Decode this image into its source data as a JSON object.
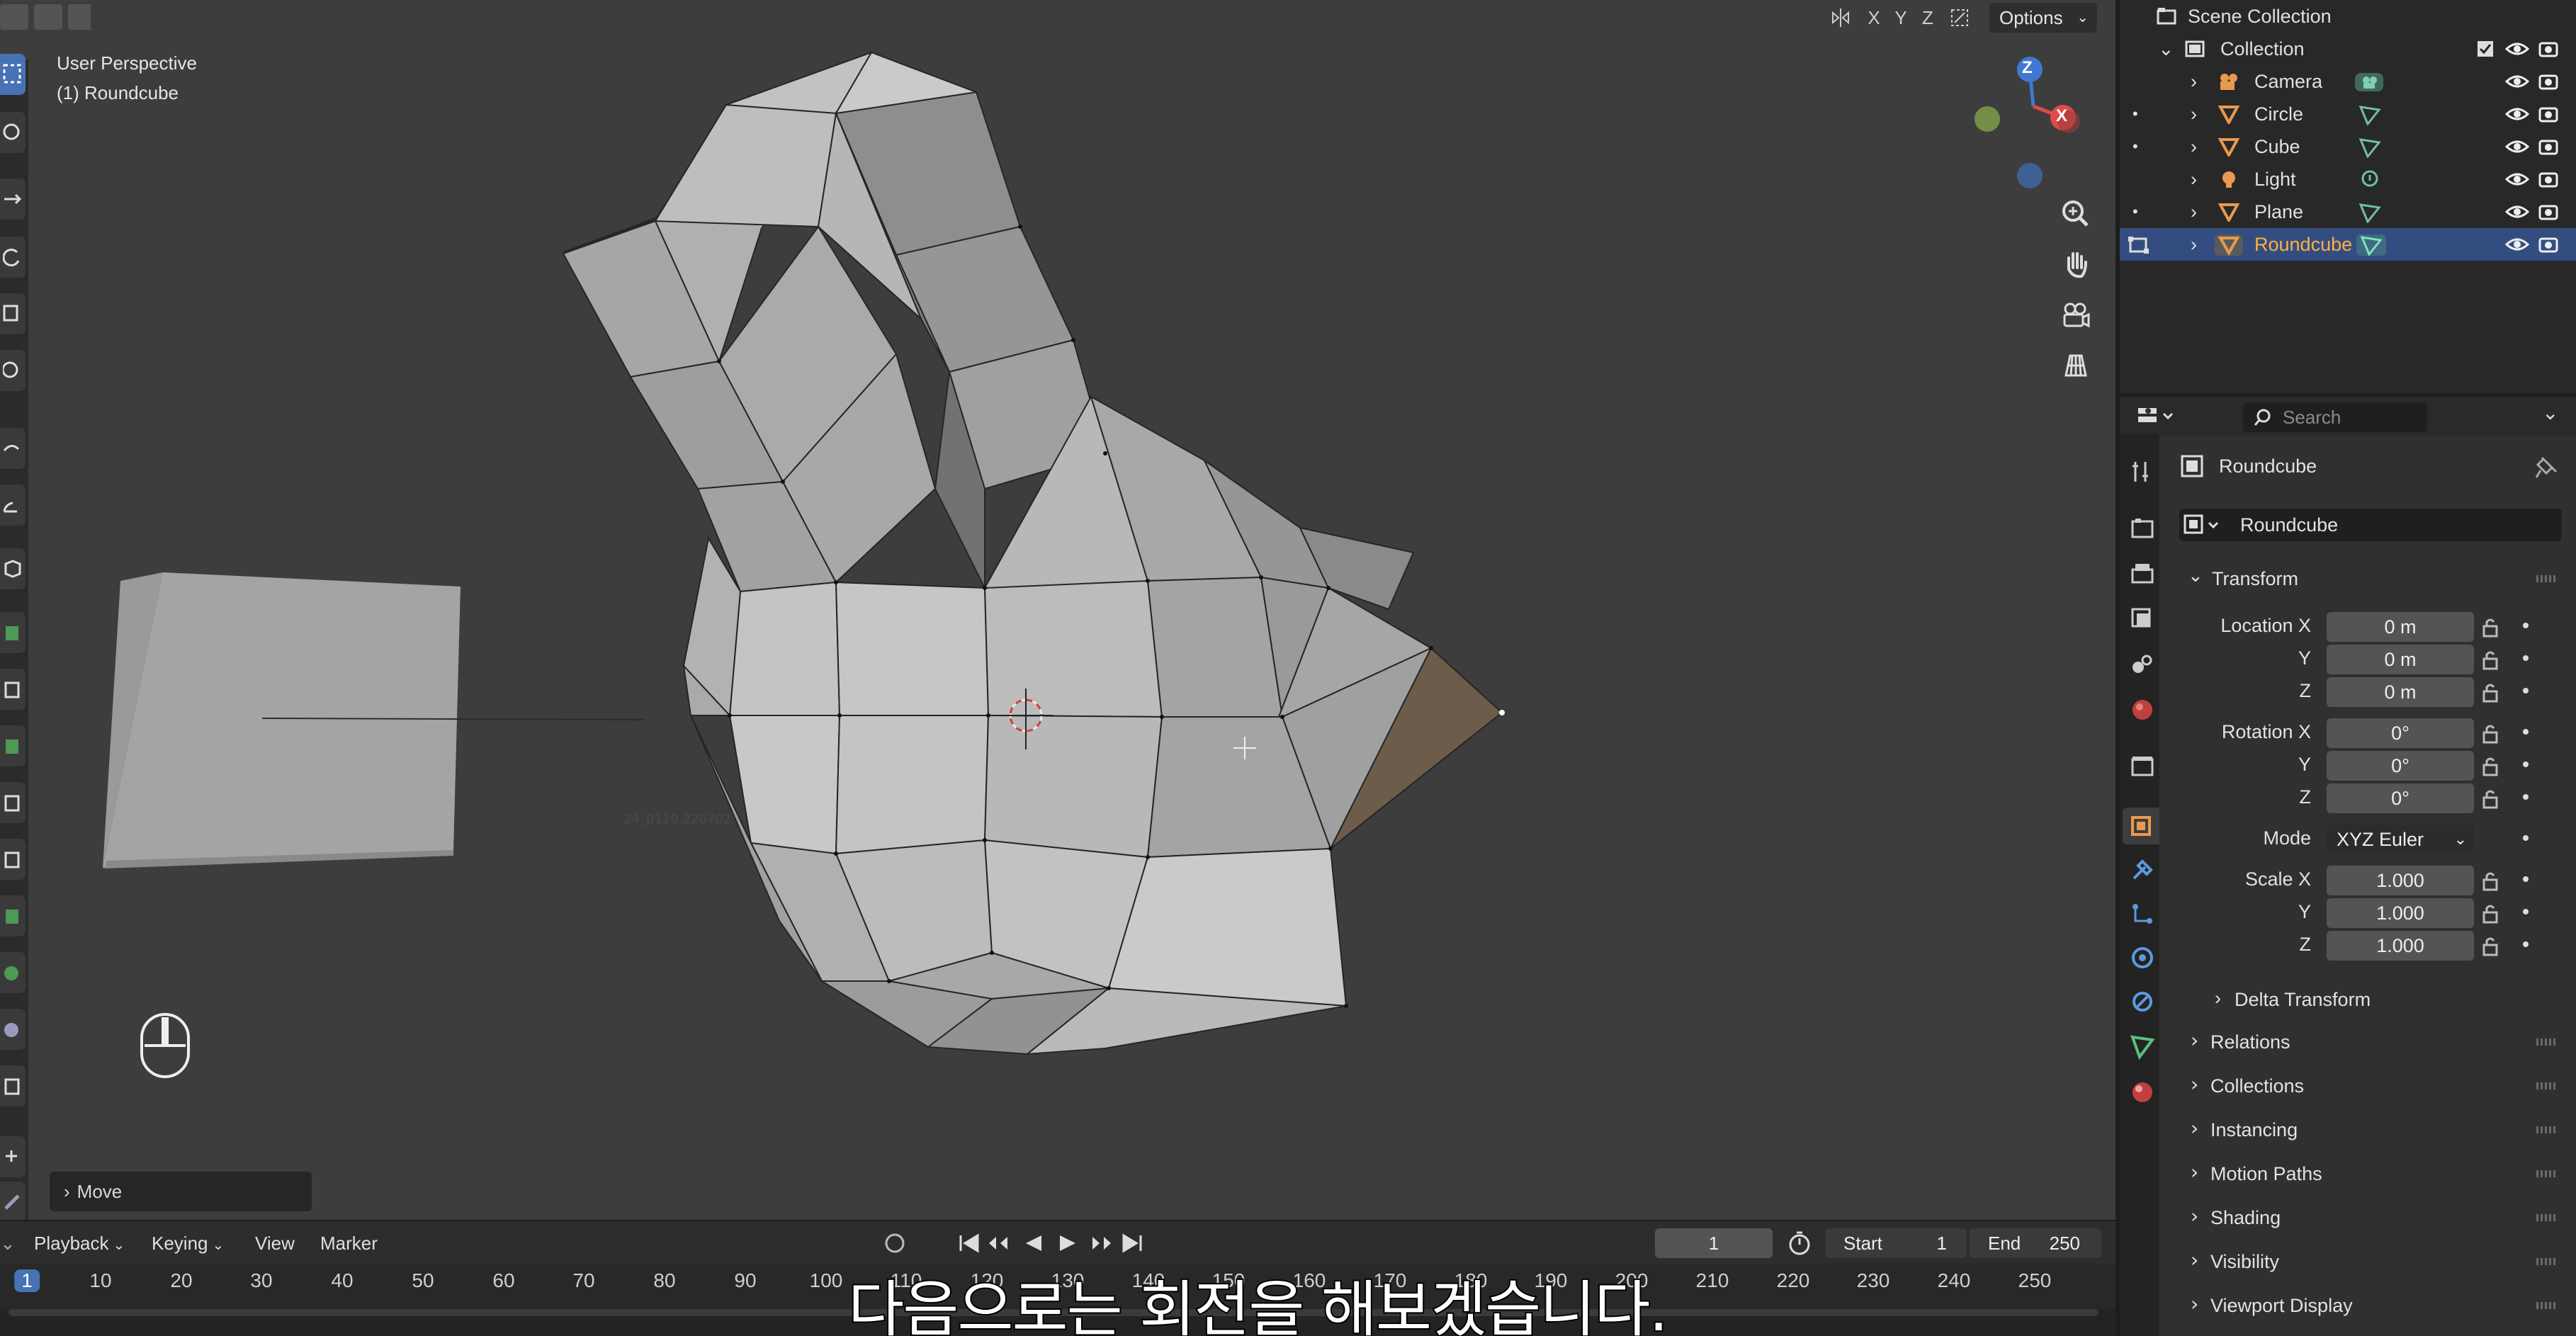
{
  "viewport": {
    "perspective_label": "User Perspective",
    "object_label": "(1) Roundcube",
    "faint_label": "24_0110 220702",
    "axis_buttons": [
      "X",
      "Y",
      "Z"
    ],
    "options_label": "Options",
    "gizmo": {
      "x": "X",
      "y": "Y",
      "z": "Z"
    },
    "operator_panel": "Move"
  },
  "timeline": {
    "menus": {
      "playback": "Playback",
      "keying": "Keying",
      "view": "View",
      "marker": "Marker"
    },
    "current_frame": "1",
    "start_label": "Start",
    "start_value": "1",
    "end_label": "End",
    "end_value": "250",
    "ruler": [
      "1",
      "10",
      "20",
      "30",
      "40",
      "50",
      "60",
      "70",
      "80",
      "90",
      "100",
      "110",
      "120",
      "130",
      "140",
      "150",
      "160",
      "170",
      "180",
      "190",
      "200",
      "210",
      "220",
      "230",
      "240",
      "250"
    ]
  },
  "subtitle": "다음으로는 회전을 해보겠습니다.",
  "outliner": {
    "scene_collection": "Scene Collection",
    "collection": "Collection",
    "items": [
      {
        "name": "Camera",
        "type": "camera"
      },
      {
        "name": "Circle",
        "type": "mesh"
      },
      {
        "name": "Cube",
        "type": "mesh"
      },
      {
        "name": "Light",
        "type": "light"
      },
      {
        "name": "Plane",
        "type": "mesh"
      },
      {
        "name": "Roundcube",
        "type": "mesh",
        "selected": true
      }
    ]
  },
  "properties": {
    "search_placeholder": "Search",
    "context_name": "Roundcube",
    "object_name": "Roundcube",
    "transform": {
      "title": "Transform",
      "location_label": "Location X",
      "location": [
        "0 m",
        "0 m",
        "0 m"
      ],
      "rotation_label": "Rotation X",
      "rotation": [
        "0°",
        "0°",
        "0°"
      ],
      "mode_label": "Mode",
      "mode_value": "XYZ Euler",
      "scale_label": "Scale X",
      "scale": [
        "1.000",
        "1.000",
        "1.000"
      ],
      "axis_y": "Y",
      "axis_z": "Z",
      "delta": "Delta Transform"
    },
    "sections": [
      "Relations",
      "Collections",
      "Instancing",
      "Motion Paths",
      "Shading",
      "Visibility",
      "Viewport Display"
    ]
  },
  "colors": {
    "accent_blue": "#4772b3",
    "selected_text": "#ffb040",
    "gizmo_x": "#e04a4a",
    "gizmo_y": "#8ab04a",
    "gizmo_z": "#3f78d0"
  }
}
